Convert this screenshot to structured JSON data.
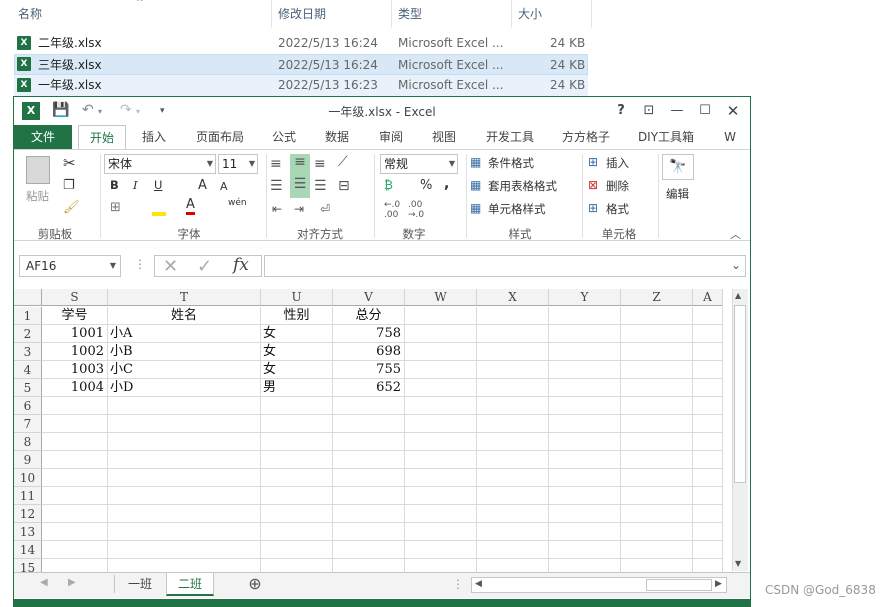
{
  "explorer": {
    "columns": {
      "name": "名称",
      "modified": "修改日期",
      "type": "类型",
      "size": "大小"
    },
    "files": [
      {
        "name": "二年级.xlsx",
        "modified": "2022/5/13 16:24",
        "type": "Microsoft Excel ...",
        "size": "24 KB"
      },
      {
        "name": "三年级.xlsx",
        "modified": "2022/5/13 16:24",
        "type": "Microsoft Excel ...",
        "size": "24 KB"
      },
      {
        "name": "一年级.xlsx",
        "modified": "2022/5/13 16:23",
        "type": "Microsoft Excel ...",
        "size": "24 KB"
      }
    ]
  },
  "excel": {
    "title": "一年级.xlsx - Excel",
    "tabs": {
      "file": "文件",
      "home": "开始",
      "insert": "插入",
      "layout": "页面布局",
      "formulas": "公式",
      "data": "数据",
      "review": "审阅",
      "view": "视图",
      "developer": "开发工具",
      "ffcell": "方方格子",
      "diy": "DIY工具箱",
      "more": "W"
    },
    "ribbon": {
      "paste": "粘贴",
      "font_name": "宋体",
      "font_size": "11",
      "bold": "B",
      "italic": "I",
      "underline": "U",
      "grow": "A",
      "shrink": "A",
      "font_color_letter": "A",
      "wen": "wén",
      "number_format": "常规",
      "percent": "%",
      "comma": ",",
      "cond_format": "条件格式",
      "table_format": "套用表格格式",
      "cell_style": "单元格样式",
      "insert": "插入",
      "delete": "删除",
      "format": "格式",
      "edit": "编辑",
      "groups": {
        "clipboard": "剪贴板",
        "font": "字体",
        "align": "对齐方式",
        "number": "数字",
        "styles": "样式",
        "cells": "单元格"
      }
    },
    "namebox": "AF16",
    "fx": "fx",
    "columns": [
      "S",
      "T",
      "U",
      "V",
      "W",
      "X",
      "Y",
      "Z",
      "A"
    ],
    "rows": [
      "1",
      "2",
      "3",
      "4",
      "5",
      "6",
      "7",
      "8",
      "9",
      "10",
      "11",
      "12",
      "13",
      "14",
      "15"
    ],
    "headers": [
      "学号",
      "姓名",
      "性别",
      "总分"
    ],
    "data": [
      [
        "1001",
        "小A",
        "女",
        "758"
      ],
      [
        "1002",
        "小B",
        "女",
        "698"
      ],
      [
        "1003",
        "小C",
        "女",
        "755"
      ],
      [
        "1004",
        "小D",
        "男",
        "652"
      ]
    ],
    "sheets": [
      "一班",
      "二班"
    ],
    "add_sheet": "⊕"
  },
  "watermark": "CSDN @God_6838",
  "colors": {
    "excel_green": "#217346"
  }
}
